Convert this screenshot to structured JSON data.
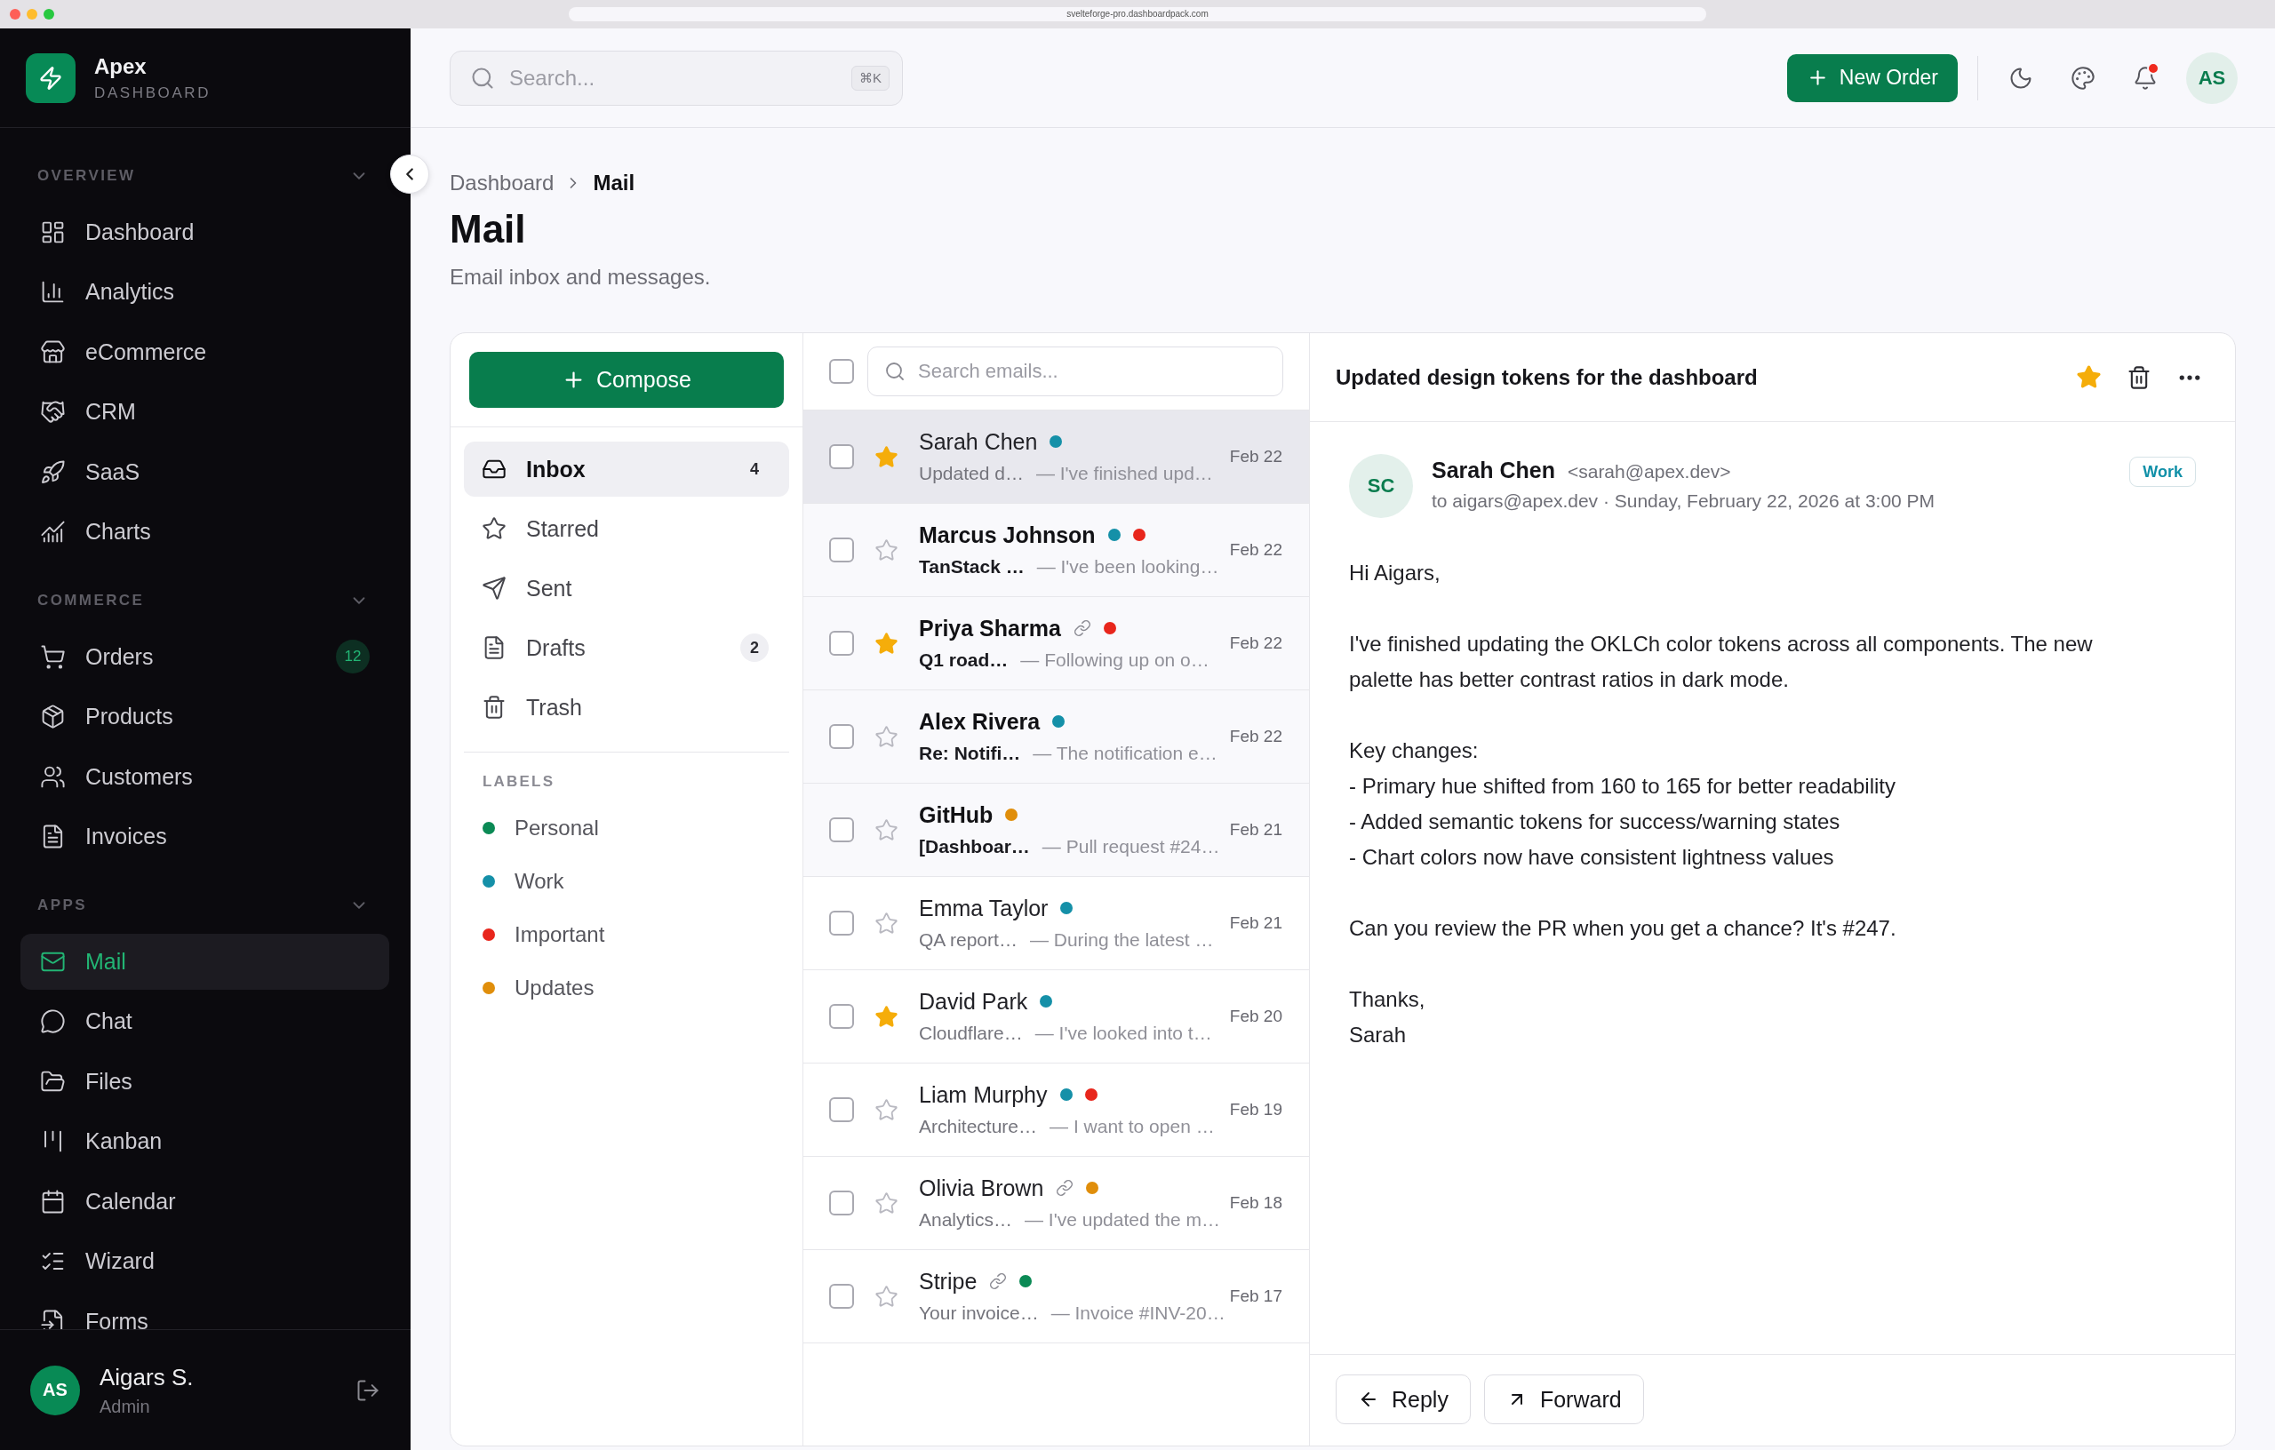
{
  "browser": {
    "url": "svelteforge-pro.dashboardpack.com"
  },
  "sidebar": {
    "brand": {
      "name": "Apex",
      "tagline": "DASHBOARD"
    },
    "sections": [
      {
        "title": "OVERVIEW",
        "expanded": true,
        "items": [
          {
            "label": "Dashboard",
            "selected": false
          },
          {
            "label": "Analytics",
            "selected": false
          },
          {
            "label": "eCommerce",
            "selected": false
          },
          {
            "label": "CRM",
            "selected": false
          },
          {
            "label": "SaaS",
            "selected": false
          },
          {
            "label": "Charts",
            "selected": false
          }
        ]
      },
      {
        "title": "COMMERCE",
        "expanded": true,
        "items": [
          {
            "label": "Orders",
            "selected": false,
            "badge": "12"
          },
          {
            "label": "Products",
            "selected": false
          },
          {
            "label": "Customers",
            "selected": false
          },
          {
            "label": "Invoices",
            "selected": false
          }
        ]
      },
      {
        "title": "APPS",
        "expanded": true,
        "items": [
          {
            "label": "Mail",
            "selected": true
          },
          {
            "label": "Chat",
            "selected": false
          },
          {
            "label": "Files",
            "selected": false
          },
          {
            "label": "Kanban",
            "selected": false
          },
          {
            "label": "Calendar",
            "selected": false
          },
          {
            "label": "Wizard",
            "selected": false
          },
          {
            "label": "Forms",
            "selected": false
          }
        ]
      }
    ],
    "user": {
      "initials": "AS",
      "name": "Aigars S.",
      "role": "Admin"
    }
  },
  "topbar": {
    "search": {
      "placeholder": "Search...",
      "shortcut": "⌘K"
    },
    "new_button": "New Order",
    "notifications_unread": true,
    "avatar": "AS"
  },
  "page": {
    "breadcrumb": [
      "Dashboard",
      "Mail"
    ],
    "title": "Mail",
    "subtitle": "Email inbox and messages."
  },
  "mail": {
    "compose": "Compose",
    "folders": [
      {
        "label": "Inbox",
        "count": "4",
        "selected": true
      },
      {
        "label": "Starred",
        "selected": false
      },
      {
        "label": "Sent",
        "selected": false
      },
      {
        "label": "Drafts",
        "count": "2",
        "selected": false
      },
      {
        "label": "Trash",
        "selected": false
      }
    ],
    "labels_title": "LABELS",
    "labels": [
      {
        "name": "Personal",
        "color": "#0b8a55"
      },
      {
        "name": "Work",
        "color": "#1590a8"
      },
      {
        "name": "Important",
        "color": "#e8261c"
      },
      {
        "name": "Updates",
        "color": "#e08e0b"
      }
    ],
    "list": {
      "select_all": false,
      "search": {
        "placeholder": "Search emails..."
      },
      "emails": [
        {
          "sender": "Sarah Chen",
          "subject": "Updated d…",
          "preview": "— I've finished upd…",
          "date": "Feb 22",
          "unread": false,
          "starred": true,
          "selected": true,
          "checked": false,
          "attachment": false,
          "dots": [
            {
              "color": "#1590a8"
            }
          ]
        },
        {
          "sender": "Marcus Johnson",
          "subject": "TanStack …",
          "preview": "— I've been looking…",
          "date": "Feb 22",
          "unread": true,
          "starred": false,
          "selected": false,
          "checked": false,
          "attachment": false,
          "dots": [
            {
              "color": "#1590a8"
            },
            {
              "color": "#e8261c"
            }
          ]
        },
        {
          "sender": "Priya Sharma",
          "subject": "Q1 road…",
          "preview": "— Following up on o…",
          "date": "Feb 22",
          "unread": true,
          "starred": true,
          "selected": false,
          "checked": false,
          "attachment": true,
          "dots": [
            {
              "color": "#e8261c"
            }
          ]
        },
        {
          "sender": "Alex Rivera",
          "subject": "Re: Notifi…",
          "preview": "— The notification e…",
          "date": "Feb 22",
          "unread": true,
          "starred": false,
          "selected": false,
          "checked": false,
          "attachment": false,
          "dots": [
            {
              "color": "#1590a8"
            }
          ]
        },
        {
          "sender": "GitHub",
          "subject": "[Dashboar…",
          "preview": "— Pull request #24…",
          "date": "Feb 21",
          "unread": true,
          "starred": false,
          "selected": false,
          "checked": false,
          "attachment": false,
          "dots": [
            {
              "color": "#e08e0b"
            }
          ]
        },
        {
          "sender": "Emma Taylor",
          "subject": "QA report…",
          "preview": "— During the latest …",
          "date": "Feb 21",
          "unread": false,
          "starred": false,
          "selected": false,
          "checked": false,
          "attachment": false,
          "dots": [
            {
              "color": "#1590a8"
            }
          ]
        },
        {
          "sender": "David Park",
          "subject": "Cloudflare…",
          "preview": "— I've looked into t…",
          "date": "Feb 20",
          "unread": false,
          "starred": true,
          "selected": false,
          "checked": false,
          "attachment": false,
          "dots": [
            {
              "color": "#1590a8"
            }
          ]
        },
        {
          "sender": "Liam Murphy",
          "subject": "Architecture…",
          "preview": "— I want to open …",
          "date": "Feb 19",
          "unread": false,
          "starred": false,
          "selected": false,
          "checked": false,
          "attachment": false,
          "dots": [
            {
              "color": "#1590a8"
            },
            {
              "color": "#e8261c"
            }
          ]
        },
        {
          "sender": "Olivia Brown",
          "subject": "Analytics…",
          "preview": "— I've updated the m…",
          "date": "Feb 18",
          "unread": false,
          "starred": false,
          "selected": false,
          "checked": false,
          "attachment": true,
          "dots": [
            {
              "color": "#e08e0b"
            }
          ]
        },
        {
          "sender": "Stripe",
          "subject": "Your invoice…",
          "preview": "— Invoice #INV-20…",
          "date": "Feb 17",
          "unread": false,
          "starred": false,
          "selected": false,
          "checked": false,
          "attachment": true,
          "dots": [
            {
              "color": "#0b8a55"
            }
          ]
        }
      ]
    },
    "reader": {
      "subject": "Updated design tokens for the dashboard",
      "starred": true,
      "sender": {
        "initials": "SC",
        "name": "Sarah Chen",
        "email": "<sarah@apex.dev>"
      },
      "meta": "to aigars@apex.dev · Sunday, February 22, 2026 at 3:00 PM",
      "tag": "Work",
      "body": [
        [
          "Hi Aigars,"
        ],
        [
          "I've finished updating the OKLCh color tokens across all components. The new palette has better contrast ratios in dark mode."
        ],
        [
          "Key changes:",
          "- Primary hue shifted from 160 to 165 for better readability",
          "- Added semantic tokens for success/warning states",
          "- Chart colors now have consistent lightness values"
        ],
        [
          "Can you review the PR when you get a chance? It's #247."
        ],
        [
          "Thanks,",
          "Sarah"
        ]
      ],
      "actions": [
        "Reply",
        "Forward"
      ]
    }
  }
}
